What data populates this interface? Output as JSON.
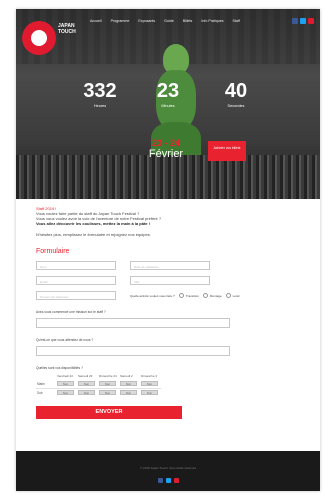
{
  "header": {
    "logo_line1": "JAPAN",
    "logo_line2": "TOUCH",
    "nav": [
      "Accueil",
      "Programme",
      "Exposants",
      "Guide",
      "Billets",
      "Info Pratiques",
      "Staff"
    ],
    "social_colors": [
      "#3b5998",
      "#1da1f2",
      "#e01b2f"
    ]
  },
  "hero": {
    "counters": [
      {
        "value": "332",
        "label": "Heures"
      },
      {
        "value": "23",
        "label": "Minutes"
      },
      {
        "value": "40",
        "label": "Secondes"
      }
    ],
    "dates_days": "23 - 24",
    "dates_month": "Février",
    "cta_label": "Acheter vos billets"
  },
  "intro": {
    "title": "Staff 2019 !",
    "line1": "Vous voulez faire partie du staff du Japan Touch Festival ?",
    "line2": "Vous vous voulez avoir la voix de l'aventure de notre Festival préféré ?",
    "line3": "Vous allez découvrir les coulisses, mettez la main à la pâte !",
    "line4": "N'hésitez plus, remplissez le formulaire et rejoignez nos équipes."
  },
  "form": {
    "title": "Formulaire",
    "fields": {
      "nom": "Nom",
      "prenom": "Date de naissance",
      "email": "Email",
      "ville": "Ville",
      "tel": "Numéro de téléphone"
    },
    "gender_question": "Quelle activité voulez-vous faire ?",
    "gender_options": [
      "Transition",
      "Montage",
      "Loisir"
    ],
    "q1": "Avez-vous commencé une mission sur le staff ?",
    "q2": "Qu'est-ce que vous attendez de nous ?",
    "availability_title": "Quelles sont vos disponibilités ?",
    "days": [
      "Vendredi 22",
      "Samedi 23",
      "Dimanche 24",
      "Samedi 2",
      "Dimanche 3"
    ],
    "rows": [
      {
        "label": "Matin",
        "cells": [
          "Non",
          "Non",
          "Non",
          "Non",
          "Non"
        ]
      },
      {
        "label": "Soir",
        "cells": [
          "Non",
          "Non",
          "Non",
          "Non",
          "Non"
        ]
      }
    ],
    "submit_label": "ENVOYER"
  },
  "footer": {
    "copy": "© 2018 Japan Touch. Tous droits réservés",
    "social_colors": [
      "#3b5998",
      "#1da1f2",
      "#e01b2f"
    ]
  }
}
